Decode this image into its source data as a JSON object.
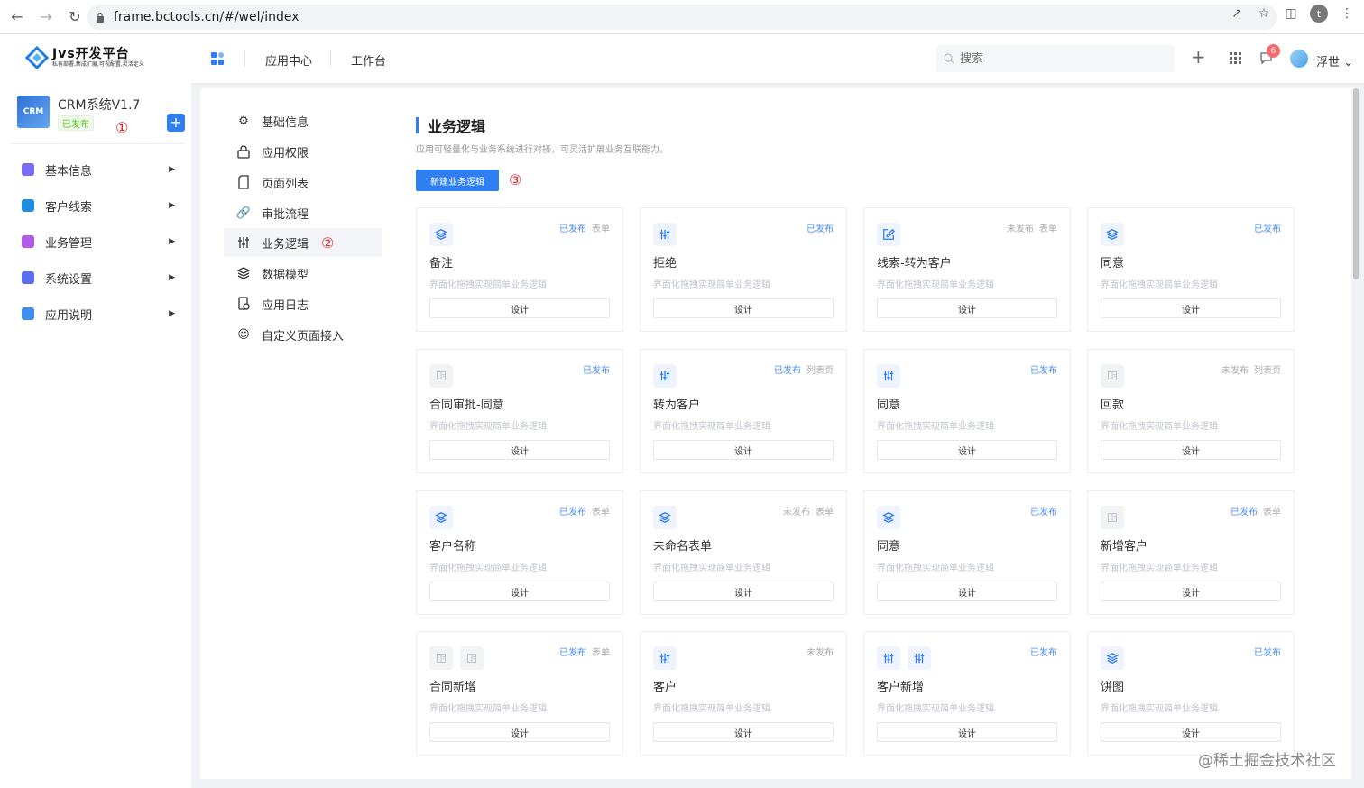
{
  "browser": {
    "url": "frame.bctools.cn/#/wel/index",
    "profile_initial": "t"
  },
  "header": {
    "logo_title": "Jvs开发平台",
    "logo_subtitle": "私有部署,集成扩展,可视配置,灵活定义",
    "nav": [
      "应用中心",
      "工作台"
    ],
    "search_placeholder": "搜索",
    "notification_count": "6",
    "user_name": "浮世"
  },
  "sidebar": {
    "app_name": "CRM系统V1.7",
    "app_thumb_text": "CRM",
    "app_status": "已发布",
    "mark1": "①",
    "items": [
      {
        "label": "基本信息",
        "color": "#7b6cf6"
      },
      {
        "label": "客户线索",
        "color": "#1e8ee0"
      },
      {
        "label": "业务管理",
        "color": "#b05ce8"
      },
      {
        "label": "系统设置",
        "color": "#5a6ff0"
      },
      {
        "label": "应用说明",
        "color": "#3f8ff0"
      }
    ]
  },
  "submenu": {
    "mark2": "②",
    "items": [
      {
        "label": "基础信息",
        "icon": "gear-icon"
      },
      {
        "label": "应用权限",
        "icon": "lock-icon"
      },
      {
        "label": "页面列表",
        "icon": "page-icon"
      },
      {
        "label": "审批流程",
        "icon": "link-icon"
      },
      {
        "label": "业务逻辑",
        "icon": "sliders-icon"
      },
      {
        "label": "数据模型",
        "icon": "layers-icon"
      },
      {
        "label": "应用日志",
        "icon": "log-icon"
      },
      {
        "label": "自定义页面接入",
        "icon": "smile-icon"
      }
    ]
  },
  "main": {
    "title": "业务逻辑",
    "description": "应用可轻量化与业务系统进行对接，可灵活扩展业务互联能力。",
    "new_button": "新建业务逻辑",
    "mark3": "③",
    "design_label": "设计",
    "cards": [
      {
        "name": "备注",
        "status": "已发布",
        "type": "表单",
        "published": true,
        "icons": [
          "layers-icon"
        ],
        "desc": "界面化拖拽实现简单业务逻辑"
      },
      {
        "name": "拒绝",
        "status": "已发布",
        "type": "",
        "published": true,
        "icons": [
          "sliders-icon"
        ],
        "desc": "界面化拖拽实现简单业务逻辑"
      },
      {
        "name": "线索-转为客户",
        "status": "未发布",
        "type": "表单",
        "published": false,
        "icons": [
          "edit-icon"
        ],
        "desc": "界面化拖拽实现简单业务逻辑"
      },
      {
        "name": "同意",
        "status": "已发布",
        "type": "",
        "published": true,
        "icons": [
          "layers-icon"
        ],
        "desc": "界面化拖拽实现简单业务逻辑"
      },
      {
        "name": "合同审批-同意",
        "status": "已发布",
        "type": "",
        "published": true,
        "icons": [
          "doc-gray-icon"
        ],
        "desc": "界面化拖拽实现简单业务逻辑"
      },
      {
        "name": "转为客户",
        "status": "已发布",
        "type": "列表页",
        "published": true,
        "icons": [
          "sliders-icon"
        ],
        "desc": "界面化拖拽实现简单业务逻辑"
      },
      {
        "name": "同意",
        "status": "已发布",
        "type": "",
        "published": true,
        "icons": [
          "sliders-icon"
        ],
        "desc": "界面化拖拽实现简单业务逻辑"
      },
      {
        "name": "回款",
        "status": "未发布",
        "type": "列表页",
        "published": false,
        "icons": [
          "doc-gray-icon"
        ],
        "desc": "界面化拖拽实现简单业务逻辑"
      },
      {
        "name": "客户名称",
        "status": "已发布",
        "type": "表单",
        "published": true,
        "icons": [
          "layers-icon"
        ],
        "desc": "界面化拖拽实现简单业务逻辑"
      },
      {
        "name": "未命名表单",
        "status": "未发布",
        "type": "表单",
        "published": false,
        "icons": [
          "layers-icon"
        ],
        "desc": "界面化拖拽实现简单业务逻辑"
      },
      {
        "name": "同意",
        "status": "已发布",
        "type": "",
        "published": true,
        "icons": [
          "layers-icon"
        ],
        "desc": "界面化拖拽实现简单业务逻辑"
      },
      {
        "name": "新增客户",
        "status": "已发布",
        "type": "表单",
        "published": true,
        "icons": [
          "doc-gray-icon"
        ],
        "desc": "界面化拖拽实现简单业务逻辑"
      },
      {
        "name": "合同新增",
        "status": "已发布",
        "type": "表单",
        "published": true,
        "icons": [
          "doc-gray-icon",
          "doc-gray-icon"
        ],
        "desc": "界面化拖拽实现简单业务逻辑"
      },
      {
        "name": "客户",
        "status": "未发布",
        "type": "",
        "published": false,
        "icons": [
          "sliders-icon"
        ],
        "desc": "界面化拖拽实现简单业务逻辑"
      },
      {
        "name": "客户新增",
        "status": "已发布",
        "type": "",
        "published": true,
        "icons": [
          "sliders-icon",
          "sliders-icon"
        ],
        "desc": "界面化拖拽实现简单业务逻辑"
      },
      {
        "name": "饼图",
        "status": "已发布",
        "type": "",
        "published": true,
        "icons": [
          "layers-icon"
        ],
        "desc": "界面化拖拽实现简单业务逻辑"
      }
    ]
  },
  "watermark": "@稀土掘金技术社区"
}
